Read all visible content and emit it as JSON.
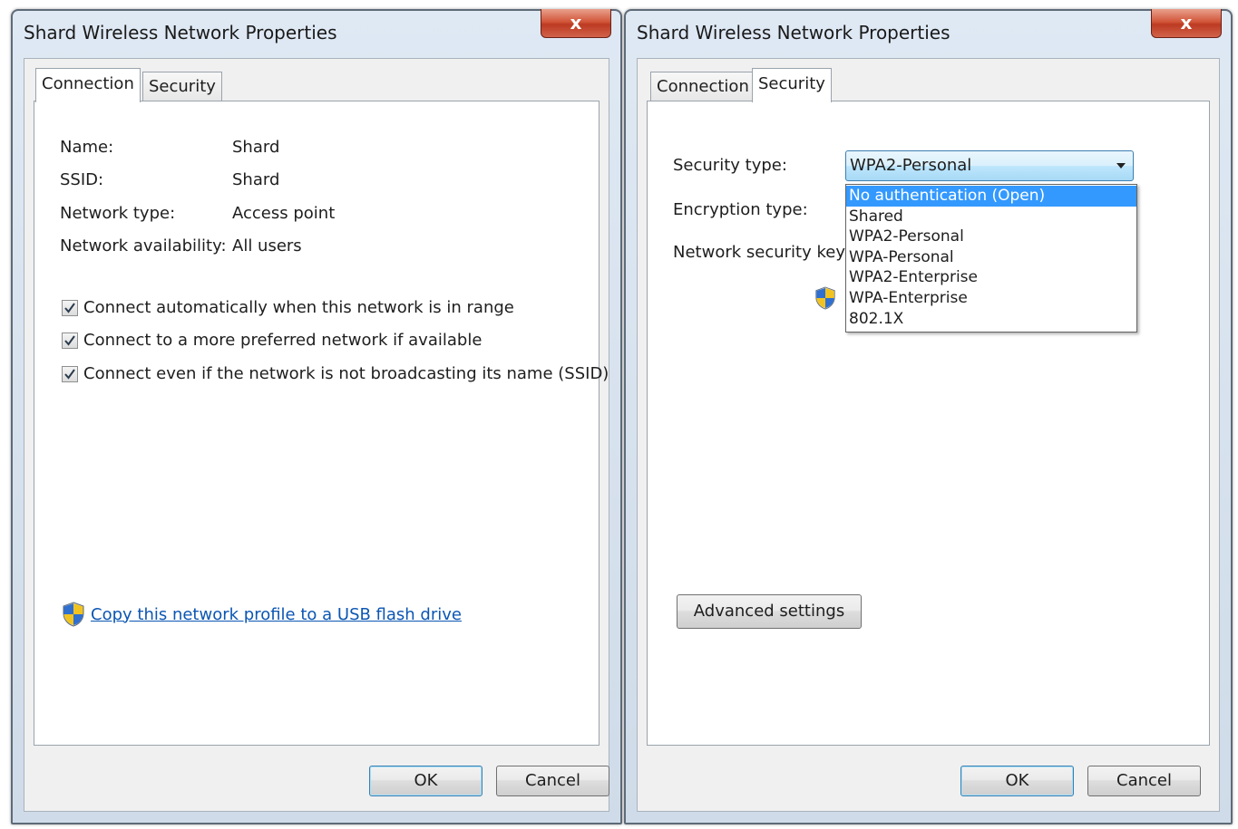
{
  "left_dialog": {
    "title": "Shard Wireless Network Properties",
    "close_label": "x",
    "tabs": [
      {
        "label": "Connection",
        "active": true
      },
      {
        "label": "Security",
        "active": false
      }
    ],
    "fields": [
      {
        "label": "Name:",
        "value": "Shard"
      },
      {
        "label": "SSID:",
        "value": "Shard"
      },
      {
        "label": "Network type:",
        "value": "Access point"
      },
      {
        "label": "Network availability:",
        "value": "All users"
      }
    ],
    "checkboxes": [
      {
        "label": "Connect automatically when this network is in range",
        "checked": true
      },
      {
        "label": "Connect to a more preferred network if available",
        "checked": true
      },
      {
        "label": "Connect even if the network is not broadcasting its name (SSID)",
        "checked": true
      }
    ],
    "link_text": "Copy this network profile to a USB flash drive",
    "ok_label": "OK",
    "cancel_label": "Cancel"
  },
  "right_dialog": {
    "title": "Shard Wireless Network Properties",
    "close_label": "x",
    "tabs": [
      {
        "label": "Connection",
        "active": false
      },
      {
        "label": "Security",
        "active": true
      }
    ],
    "security_type_label": "Security type:",
    "security_type_value": "WPA2-Personal",
    "encryption_type_label": "Encryption type:",
    "network_key_label": "Network security key",
    "dropdown_options": [
      "No authentication (Open)",
      "Shared",
      "WPA2-Personal",
      "WPA-Personal",
      "WPA2-Enterprise",
      "WPA-Enterprise",
      "802.1X"
    ],
    "highlighted_option": "No authentication (Open)",
    "advanced_label": "Advanced settings",
    "ok_label": "OK",
    "cancel_label": "Cancel"
  },
  "colors": {
    "link": "#0b56b3",
    "highlight": "#3399ff",
    "close_button": "#c8452b"
  },
  "icons": {
    "close": "close-icon",
    "checkbox": "checkmark-icon",
    "shield": "uac-shield-icon",
    "dropdown": "chevron-down-icon"
  }
}
